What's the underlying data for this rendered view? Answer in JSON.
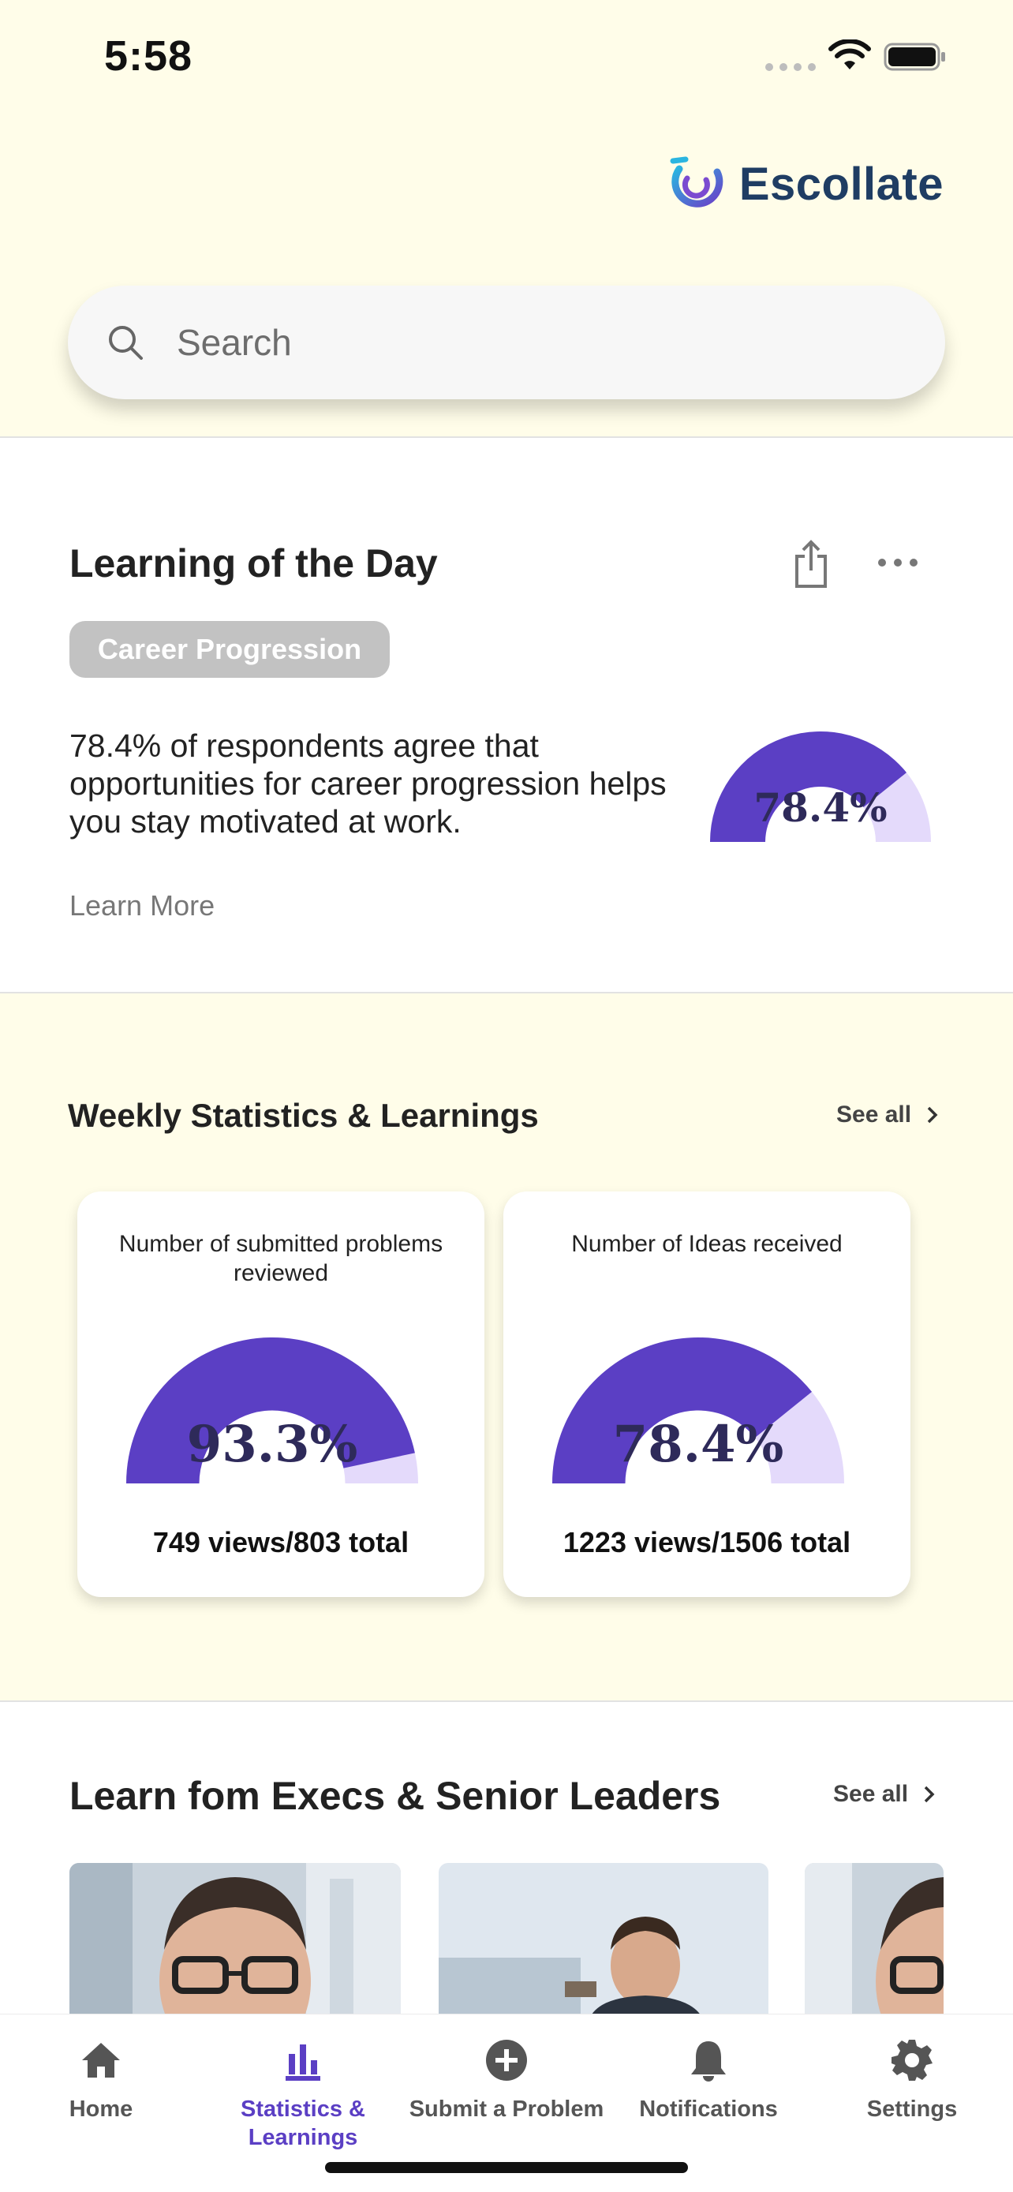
{
  "status_bar": {
    "time": "5:58"
  },
  "brand": {
    "name": "Escollate"
  },
  "search": {
    "placeholder": "Search"
  },
  "learning_of_day": {
    "title": "Learning of the Day",
    "tag": "Career Progression",
    "description": "78.4% of respondents agree that opportunities for career progression helps you stay motivated at work.",
    "learn_more": "Learn More",
    "gauge": {
      "label": "78.4%",
      "value": 0.784
    }
  },
  "weekly": {
    "title": "Weekly Statistics & Learnings",
    "see_all": "See all",
    "cards": [
      {
        "label": "Number of submitted problems reviewed",
        "gauge_label": "93.3%",
        "value": 0.933,
        "summary": "749 views/803 total"
      },
      {
        "label": "Number of Ideas received",
        "gauge_label": "78.4%",
        "value": 0.784,
        "summary": "1223 views/1506 total"
      }
    ]
  },
  "execs": {
    "title": "Learn fom Execs & Senior Leaders",
    "see_all": "See all"
  },
  "nav": {
    "items": [
      {
        "label": "Home",
        "icon": "home-icon"
      },
      {
        "label": "Statistics & Learnings",
        "icon": "bar-chart-icon",
        "active": true
      },
      {
        "label": "Submit a Problem",
        "icon": "plus-circle-icon"
      },
      {
        "label": "Notifications",
        "icon": "bell-icon"
      },
      {
        "label": "Settings",
        "icon": "gear-icon"
      }
    ]
  },
  "colors": {
    "accent": "#5b3fc4",
    "gauge_track": "#e4dafb",
    "background": "#fffde9"
  }
}
